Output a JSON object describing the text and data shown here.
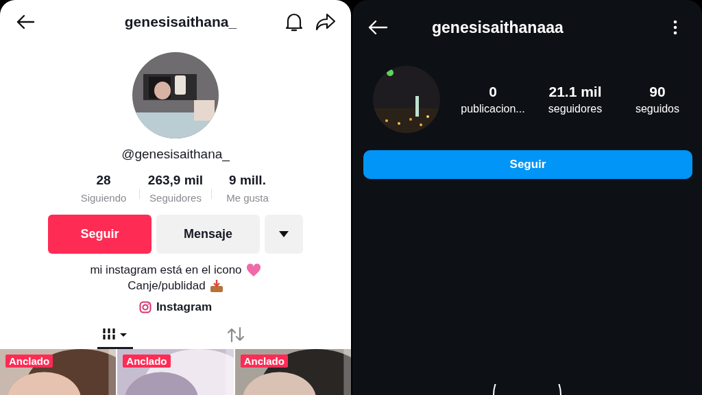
{
  "tiktok": {
    "title": "genesisaithana_",
    "handle": "@genesisaithana_",
    "stats": [
      {
        "value": "28",
        "label": "Siguiendo"
      },
      {
        "value": "263,9 mil",
        "label": "Seguidores"
      },
      {
        "value": "9 mill.",
        "label": "Me gusta"
      }
    ],
    "buttons": {
      "follow": "Seguir",
      "message": "Mensaje"
    },
    "bio": [
      "mi instagram está en el icono",
      "Canje/publidad"
    ],
    "link": "Instagram",
    "tabs": [
      {
        "kind": "videos",
        "selected": true
      },
      {
        "kind": "reposts",
        "selected": false
      }
    ],
    "videos": [
      {
        "badge": "Anclado"
      },
      {
        "badge": "Anclado"
      },
      {
        "badge": "Anclado"
      }
    ]
  },
  "instagram": {
    "title": "genesisaithanaaa",
    "stats": [
      {
        "value": "0",
        "label": "publicacion..."
      },
      {
        "value": "21.1 mil",
        "label": "seguidores"
      },
      {
        "value": "90",
        "label": "seguidos"
      }
    ],
    "follow": "Seguir"
  }
}
